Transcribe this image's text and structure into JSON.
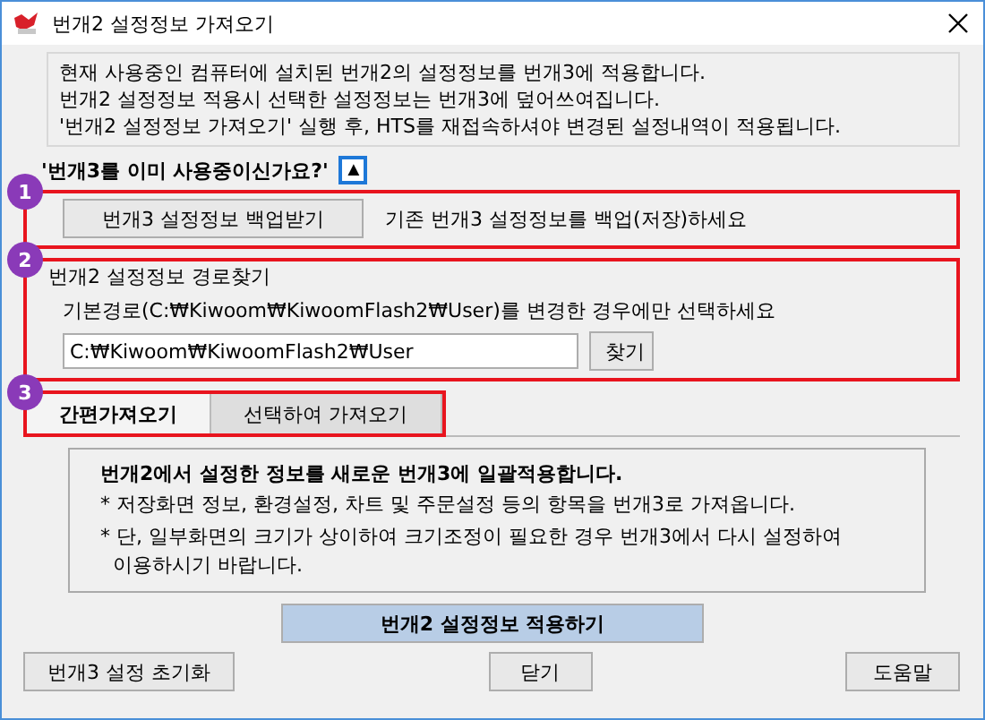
{
  "window": {
    "title": "번개2 설정정보 가져오기"
  },
  "info_lines": [
    "현재 사용중인 컴퓨터에 설치된 번개2의 설정정보를 번개3에 적용합니다.",
    "번개2 설정정보 적용시 선택한 설정정보는 번개3에 덮어쓰여집니다.",
    "'번개2 설정정보 가져오기' 실행 후, HTS를 재접속하셔야 변경된 설정내역이 적용됩니다."
  ],
  "question": {
    "text": "'번개3를 이미 사용중이신가요?'",
    "toggle": "▲"
  },
  "step1": {
    "badge": "1",
    "button": "번개3 설정정보 백업받기",
    "hint": "기존 번개3 설정정보를 백업(저장)하세요"
  },
  "step2": {
    "badge": "2",
    "legend": "번개2 설정정보 경로찾기",
    "hint": "기본경로(C:₩Kiwoom₩KiwoomFlash2₩User)를 변경한 경우에만 선택하세요",
    "path": "C:₩Kiwoom₩KiwoomFlash2₩User",
    "browse": "찾기"
  },
  "step3": {
    "badge": "3",
    "tabs": [
      {
        "label": "간편가져오기",
        "selected": true
      },
      {
        "label": "선택하여 가져오기",
        "selected": false
      }
    ]
  },
  "panel": {
    "heading": "번개2에서 설정한 정보를 새로운 번개3에 일괄적용합니다.",
    "notes": [
      "* 저장화면 정보, 환경설정, 차트 및 주문설정 등의 항목을 번개3로 가져옵니다.",
      "* 단, 일부화면의 크기가 상이하여 크기조정이 필요한 경우 번개3에서 다시 설정하여\n  이용하시기 바랍니다."
    ]
  },
  "apply_button": "번개2 설정정보 적용하기",
  "buttons": [
    "번개3 설정 초기화",
    "닫기",
    "도움말"
  ]
}
